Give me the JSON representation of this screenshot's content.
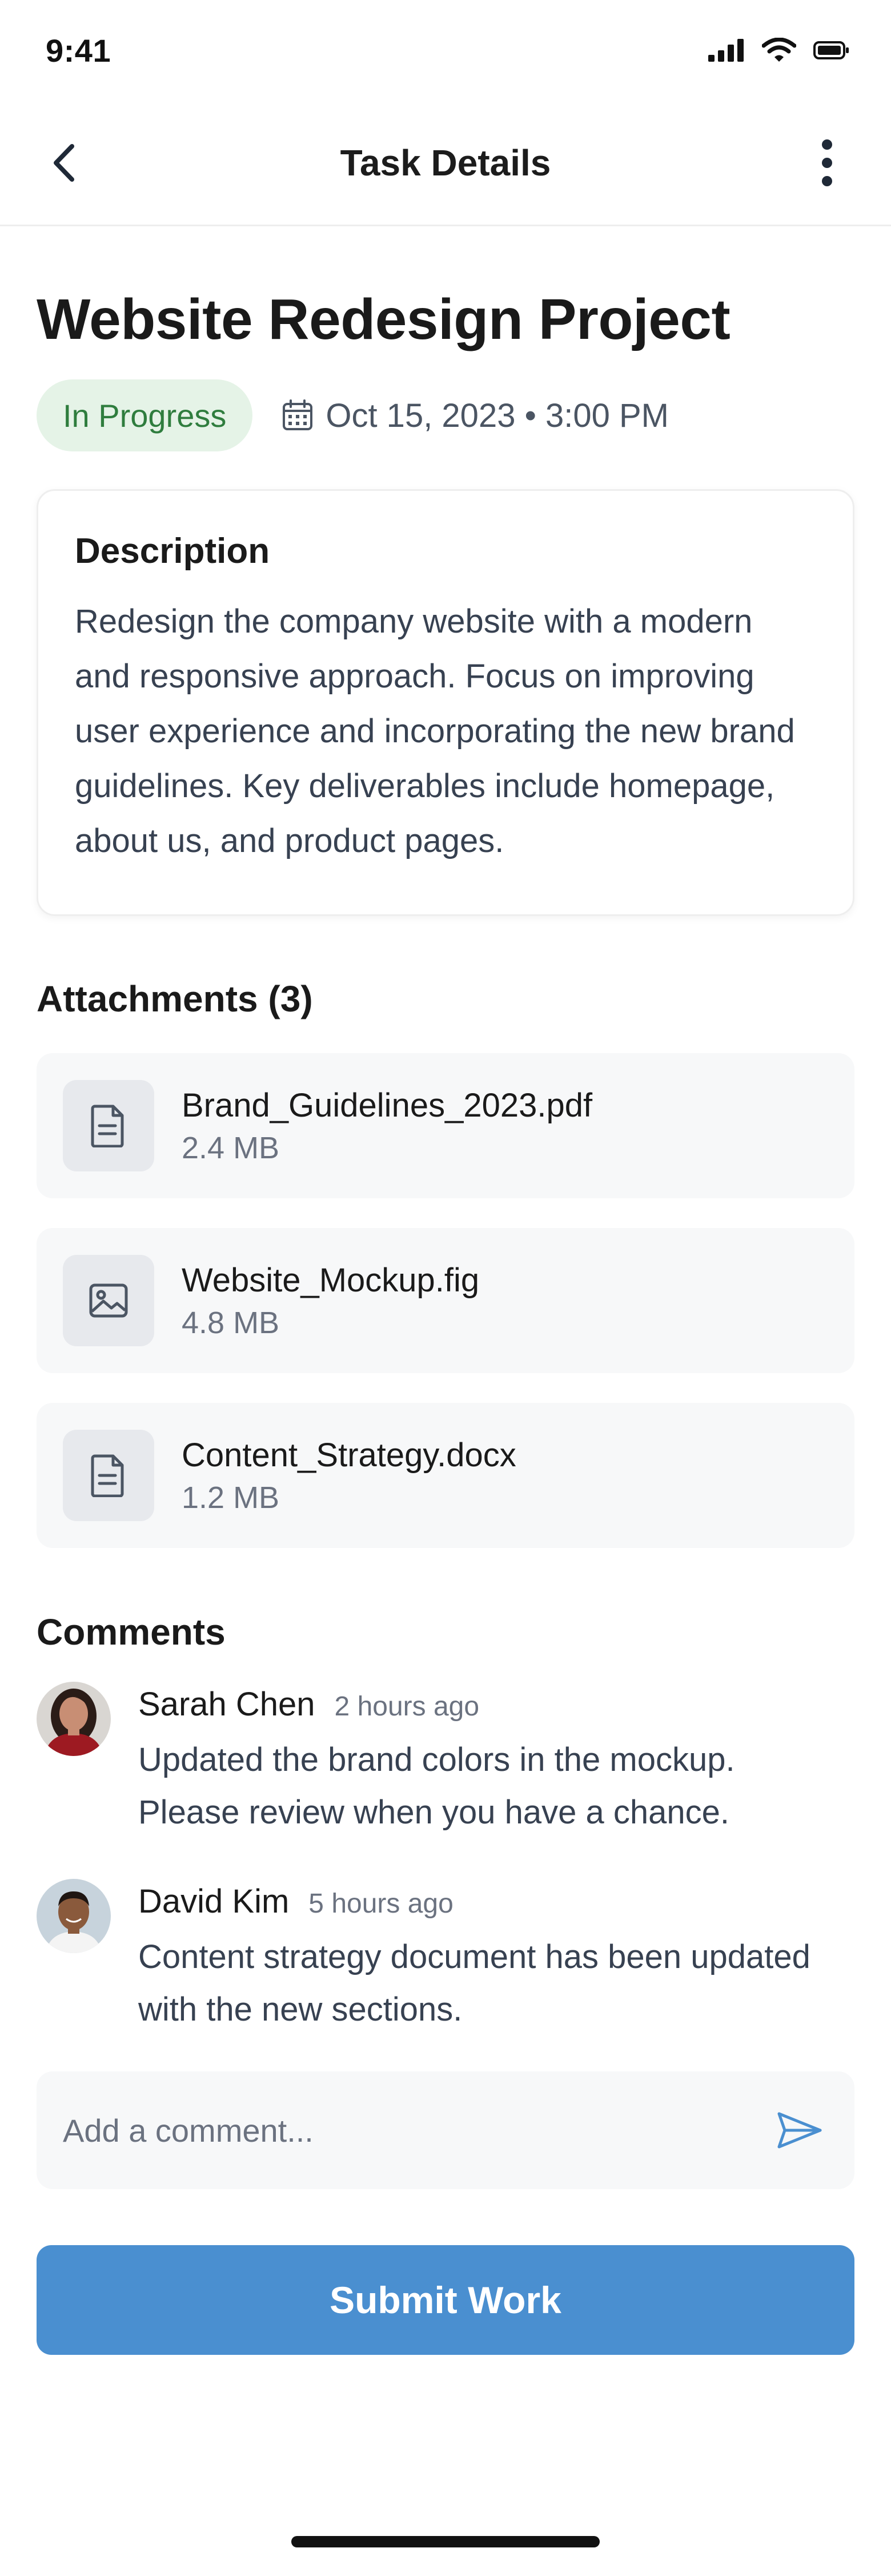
{
  "status_bar": {
    "time": "9:41"
  },
  "header": {
    "title": "Task Details"
  },
  "task": {
    "title": "Website Redesign Project",
    "status": "In Progress",
    "due": "Oct 15, 2023 • 3:00 PM"
  },
  "description": {
    "title": "Description",
    "text": "Redesign the company website with a modern and responsive approach. Focus on improving user experience and incorporating the new brand guidelines. Key deliverables include homepage, about us, and product pages."
  },
  "attachments": {
    "title": "Attachments (3)",
    "items": [
      {
        "name": "Brand_Guidelines_2023.pdf",
        "size": "2.4 MB",
        "icon": "document-icon"
      },
      {
        "name": "Website_Mockup.fig",
        "size": "4.8 MB",
        "icon": "image-icon"
      },
      {
        "name": "Content_Strategy.docx",
        "size": "1.2 MB",
        "icon": "document-icon"
      }
    ]
  },
  "comments": {
    "title": "Comments",
    "items": [
      {
        "author": "Sarah Chen",
        "time": "2 hours ago",
        "text": "Updated the brand colors in the mockup. Please review when you have a chance."
      },
      {
        "author": "David Kim",
        "time": "5 hours ago",
        "text": "Content strategy document has been updated with the new sections."
      }
    ],
    "input_placeholder": "Add a comment..."
  },
  "submit_label": "Submit Work",
  "colors": {
    "accent": "#4a8fd0",
    "status_bg": "#e5f3e7",
    "status_text": "#2f7d3e"
  }
}
